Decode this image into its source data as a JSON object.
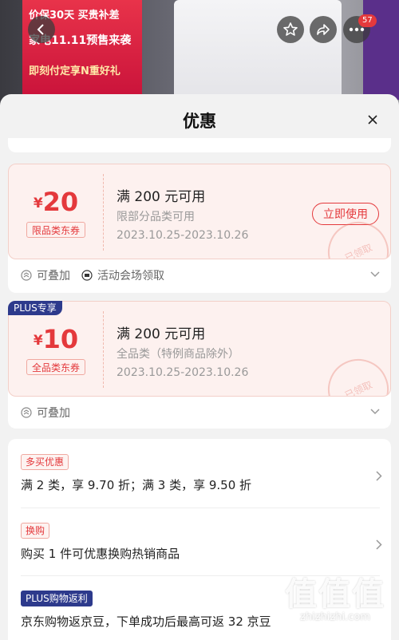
{
  "background": {
    "promo_line1": "价保30天 买贵补差",
    "promo_line2": "家电11.11预售来袭",
    "promo_line3": "即刻付定享N重好礼",
    "cart_badge": "57"
  },
  "sheet": {
    "title": "优惠"
  },
  "coupons": [
    {
      "currency": "¥",
      "amount": "20",
      "tag": "限品类东券",
      "condition": "满 200 元可用",
      "scope": "限部分品类可用",
      "date": "2023.10.25-2023.10.26",
      "button": "立即使用",
      "stamp": "已领取",
      "footer": [
        "可叠加",
        "活动会场领取"
      ]
    },
    {
      "plus_label": "PLUS专享",
      "currency": "¥",
      "amount": "10",
      "tag": "全品类东券",
      "condition": "满 200 元可用",
      "scope": "全品类（特例商品除外）",
      "date": "2023.10.25-2023.10.26",
      "stamp": "已领取",
      "footer": [
        "可叠加"
      ]
    }
  ],
  "promotions": [
    {
      "tag": "多买优惠",
      "text": "满 2 类，享 9.70 折；满 3 类，享 9.50 折"
    },
    {
      "tag": "换购",
      "text": "购买 1 件可优惠换购热销商品"
    },
    {
      "tag": "PLUS购物返利",
      "text": "京东购物返京豆，下单成功后最高可返 32 京豆"
    }
  ],
  "watermark": {
    "logo": "值值值",
    "url": "zhizhizhi.com"
  },
  "colors": {
    "accent": "#e4393c",
    "plus": "#2d3a8c",
    "coupon_bg": "#fdf1ef"
  }
}
